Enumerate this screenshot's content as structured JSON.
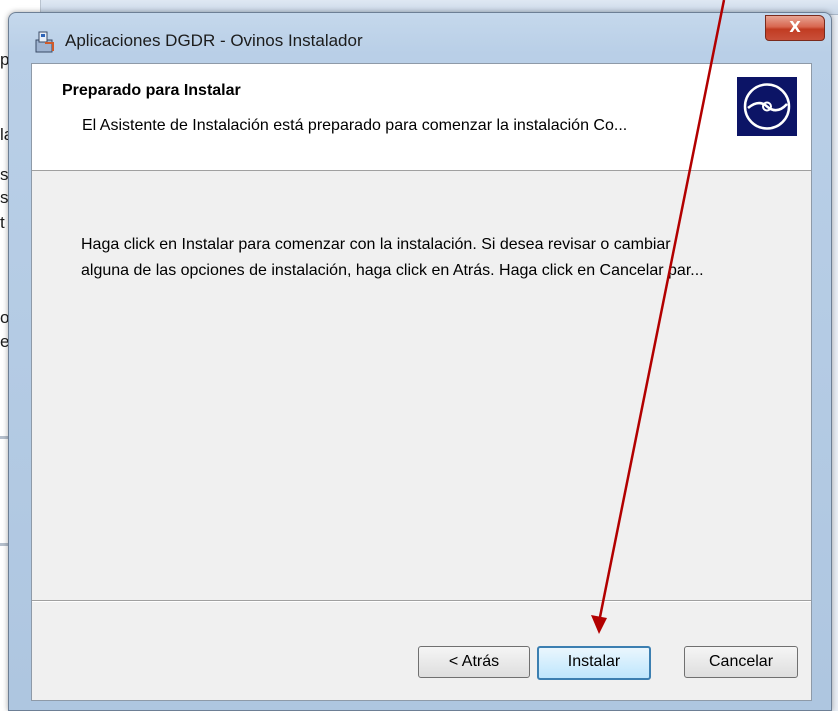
{
  "window": {
    "title": "Aplicaciones  DGDR - Ovinos Instalador",
    "close_label": "X"
  },
  "banner": {
    "title": "Preparado para Instalar",
    "subtitle": "El Asistente de Instalación está preparado para comenzar la instalación Co..."
  },
  "body": {
    "line1": "Haga click en Instalar para comenzar con la instalación.  Si desea revisar o cambiar",
    "line2": "alguna de las opciones de instalación, haga click en Atrás.  Haga click en Cancelar par..."
  },
  "buttons": {
    "back": "< Atrás",
    "install": "Instalar",
    "cancel": "Cancelar"
  },
  "background_fragments": [
    "p",
    "la",
    "s",
    "s",
    "t",
    "o",
    "e"
  ],
  "colors": {
    "annotation_arrow": "#b20000",
    "banner_icon_bg": "#0c1466",
    "close_button": "#c8462d"
  }
}
